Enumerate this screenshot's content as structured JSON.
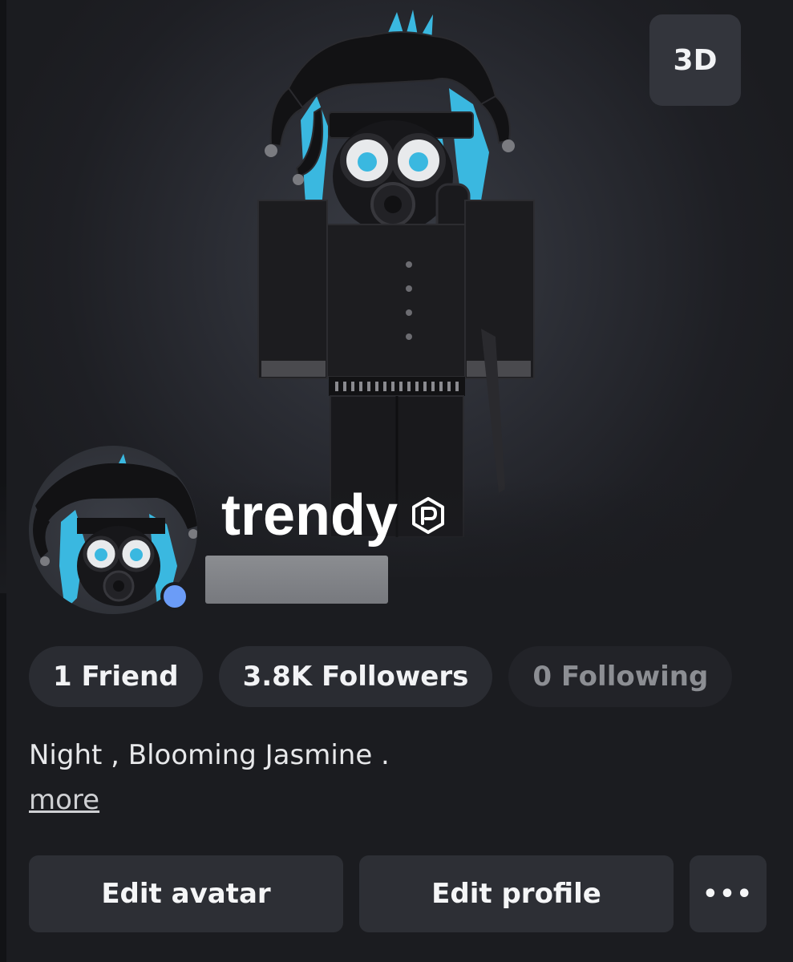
{
  "hero": {
    "toggle_3d_label": "3D"
  },
  "profile": {
    "display_name": "trendy",
    "verified_icon": "premium-badge-icon",
    "presence_status": "online",
    "presence_color": "#6b9cf7"
  },
  "stats": {
    "friends": "1 Friend",
    "followers": "3.8K Followers",
    "following": "0 Following"
  },
  "about": {
    "bio": "Night , Blooming Jasmine .",
    "more_label": "more"
  },
  "actions": {
    "edit_avatar": "Edit avatar",
    "edit_profile": "Edit profile",
    "more_icon": "ellipsis-icon",
    "more_glyph": "•••"
  }
}
